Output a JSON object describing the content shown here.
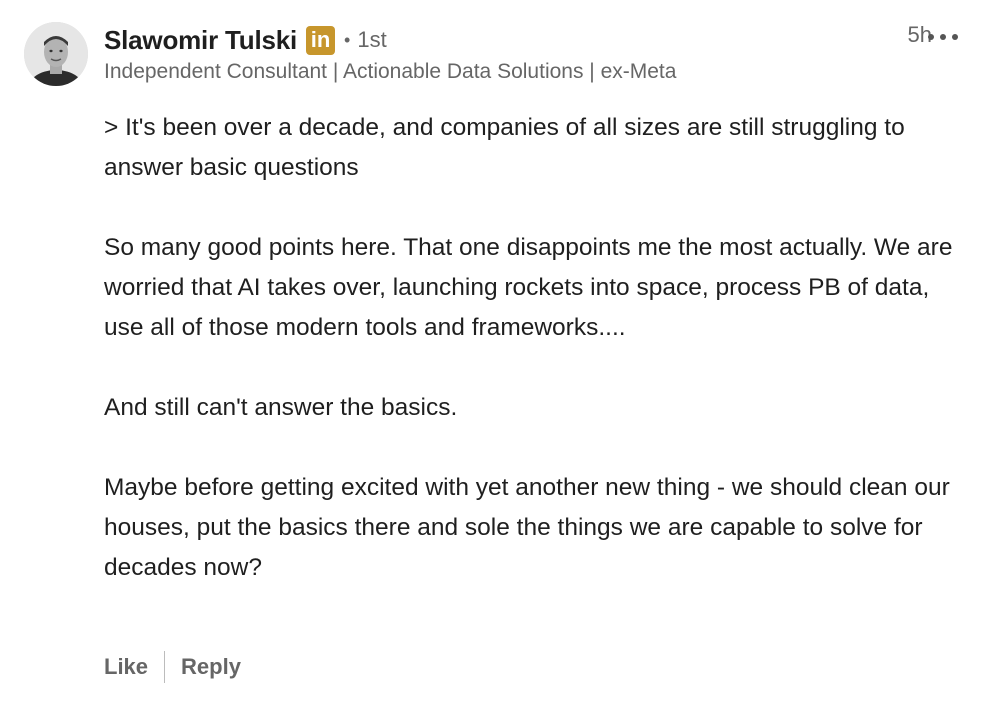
{
  "comment": {
    "author": {
      "name": "Slawomir Tulski",
      "badge_text": "in",
      "separator": "•",
      "degree": "1st",
      "headline": "Independent Consultant | Actionable Data Solutions | ex-Meta"
    },
    "timestamp": "5h",
    "paragraphs": [
      "> It's been over a decade, and companies of all sizes are still struggling to answer basic questions",
      "So many good points here. That one disappoints me the most actually. We are worried that AI takes over, launching rockets into space, process PB of data, use all of those modern tools and frameworks....",
      "And still can't answer the basics.",
      "Maybe before getting excited with yet another new thing - we should clean our houses, put the basics there and sole the things we are capable to solve for decades now?"
    ],
    "actions": {
      "like_label": "Like",
      "reply_label": "Reply"
    }
  },
  "icons": {
    "avatar": "profile-photo",
    "badge": "linkedin-icon",
    "more": "more-options-icon"
  },
  "colors": {
    "badge": "#c7962c",
    "primary_text": "#1f1f1f",
    "secondary_text": "#666666"
  }
}
